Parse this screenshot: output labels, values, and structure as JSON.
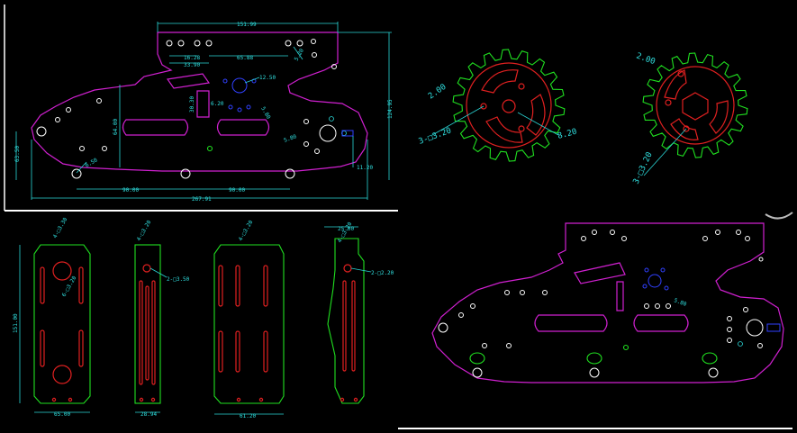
{
  "colors": {
    "background": "#000000",
    "dimension": "#2ad6d6",
    "outline": "#d020d0",
    "holes": "#ffffff",
    "cutouts": "#e02020",
    "gear": "#20e020",
    "accent": "#3040ff"
  },
  "top_left_drawing": {
    "dims": {
      "top_width": "151.99",
      "left_a": "16.28",
      "left_b": "33.90",
      "mid": "65.88",
      "dia_top": "5.20",
      "dia_center": "12.50",
      "dia_center2": "5.80",
      "slot_h": "30.30",
      "slot_w": "6.20",
      "height": "64.00",
      "right_h": "124.95",
      "left_h": "63.50",
      "small_d": "5.80",
      "hole_d": "6.50",
      "right_sq": "11.20",
      "bottom_a": "90.00",
      "bottom_b": "90.00",
      "total": "267.91",
      "small_label": "5.80"
    }
  },
  "top_right_drawing": {
    "gear1": {
      "dia_small": "2.00",
      "hole_label": "3-□3.20",
      "dia_big": "8.20"
    },
    "gear2": {
      "dia_small": "2.00",
      "hole_label": "3-□3.20"
    }
  },
  "bottom_left_drawing": {
    "part1": {
      "top": "4-□3.30",
      "height": "151.00",
      "bottom": "65.00",
      "side": "6-□3.20"
    },
    "part2": {
      "top": "4-□3.20",
      "dia": "2-□3.50",
      "bottom": "28.94"
    },
    "part3": {
      "top": "4-□3.20",
      "bottom": "61.20"
    },
    "part4": {
      "top": "25.00",
      "top2": "4-□3.20",
      "dia": "2-□2.20"
    }
  },
  "bottom_right_drawing": {
    "dim_small": "5.80"
  }
}
